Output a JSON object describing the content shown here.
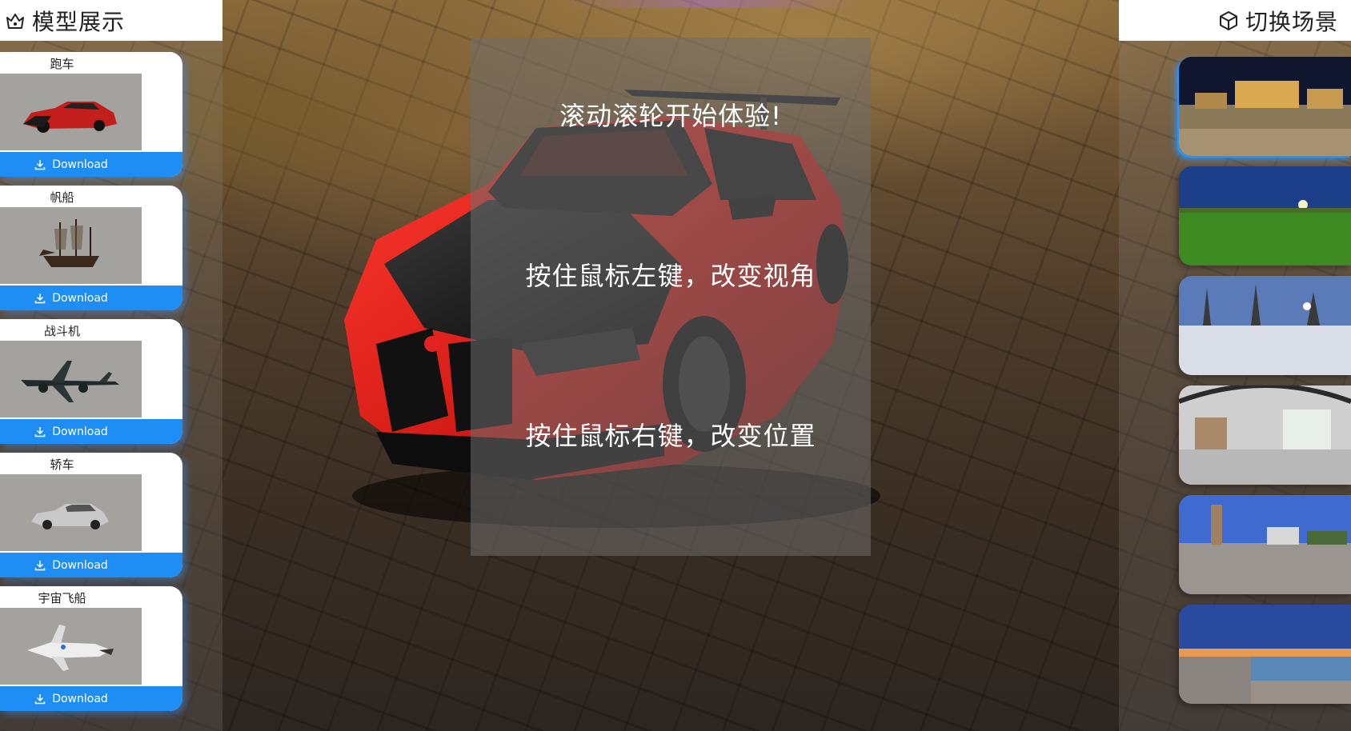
{
  "left_panel": {
    "title": "模型展示",
    "icon": "crown-home-icon",
    "models": [
      {
        "name": "跑车",
        "download_label": "Download",
        "thumb": "sports-car"
      },
      {
        "name": "帆船",
        "download_label": "Download",
        "thumb": "sailing-ship"
      },
      {
        "name": "战斗机",
        "download_label": "Download",
        "thumb": "fighter-plane"
      },
      {
        "name": "轿车",
        "download_label": "Download",
        "thumb": "sedan"
      },
      {
        "name": "宇宙飞船",
        "download_label": "Download",
        "thumb": "spaceship"
      }
    ]
  },
  "right_panel": {
    "title": "切换场景",
    "icon": "cube-icon",
    "scenes": [
      {
        "id": "night-city-square",
        "active": true
      },
      {
        "id": "green-field"
      },
      {
        "id": "snowy-park"
      },
      {
        "id": "indoor-studio"
      },
      {
        "id": "plaza-tower"
      },
      {
        "id": "seaside-sunset"
      }
    ]
  },
  "hints": {
    "scroll": "滚动滚轮开始体验!",
    "left_drag": "按住鼠标左键，改变视角",
    "right_drag": "按住鼠标右键，改变位置"
  },
  "colors": {
    "accent": "#1e8ef5",
    "car_body": "#e2231f",
    "card_bg": "#ffffff"
  }
}
